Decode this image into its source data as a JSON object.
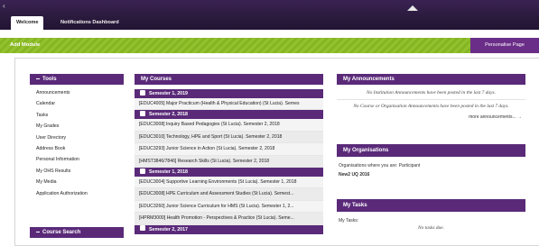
{
  "tabs": [
    {
      "label": "Welcome"
    },
    {
      "label": "Notifications Dashboard"
    }
  ],
  "toolbar": {
    "add_module": "Add Module",
    "personalise": "Personalise Page"
  },
  "tools": {
    "title": "Tools",
    "items": [
      "Announcements",
      "Calendar",
      "Tasks",
      "My Grades",
      "User Directory",
      "Address Book",
      "Personal Information",
      "My OHS Results",
      "My Media",
      "Application Authorization"
    ]
  },
  "course_search": {
    "title": "Course Search"
  },
  "courses": {
    "title": "My Courses",
    "sections": [
      {
        "label": "Semester 1, 2019",
        "items": [
          "[EDUC4005] Major Practicum (Health & Physical Education) (St Lucia). Semes"
        ]
      },
      {
        "label": "Semester 2, 2018",
        "items": [
          "[EDUC3008] Inquiry Based Pedagogies (St Lucia). Semester 2, 2018",
          "[EDUC3010] Technology, HPE and Sport (St Lucia). Semester 2, 2018",
          "[EDUC3293] Junior Science in Action (St Lucia). Semester 2, 2018",
          "[HMST3846/7846] Research Skills (St Lucia). Semester 2, 2018"
        ]
      },
      {
        "label": "Semester 1, 2018",
        "items": [
          "[EDUC3004] Supportive Learning Environments (St Lucia). Semester 1, 2018",
          "[EDUC3008] HPE Curriculum and Assessment Studies (St Lucia). Semest...",
          "[EDUC3260] Junior Science Curriculum for HMS (St Lucia). Semester 1, 2...",
          "[HPRM3000] Health Promotion - Perspectives & Practice (St Lucia). Seme..."
        ]
      },
      {
        "label": "Semester 2, 2017",
        "items": []
      }
    ]
  },
  "announcements": {
    "title": "My Announcements",
    "msg1": "No Institution Announcements have been posted in the last 7 days.",
    "msg2": "No Course or Organisation Announcements have been posted in the last 7 days.",
    "more": "more announcements... →"
  },
  "organisations": {
    "title": "My Organisations",
    "where": "Organisations where you are: Participant",
    "item": "New2 UQ 2016"
  },
  "tasks": {
    "title": "My Tasks",
    "label": "My Tasks:",
    "none": "No tasks due."
  }
}
